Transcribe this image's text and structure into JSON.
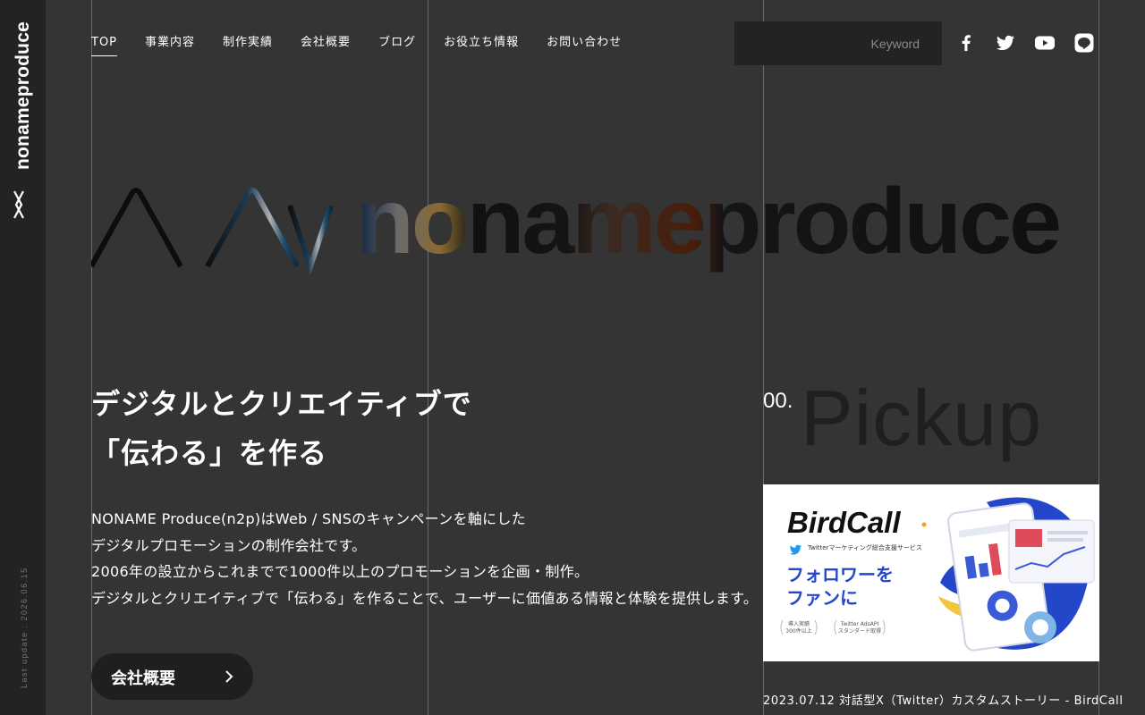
{
  "sidebar": {
    "brand": "nonameproduce",
    "last_update": "Last update : 2026.06.15"
  },
  "nav": {
    "items": [
      {
        "label": "TOP",
        "active": true
      },
      {
        "label": "事業内容"
      },
      {
        "label": "制作実績"
      },
      {
        "label": "会社概要"
      },
      {
        "label": "ブログ"
      },
      {
        "label": "お役立ち情報"
      },
      {
        "label": "お問い合わせ"
      }
    ]
  },
  "search": {
    "placeholder": "Keyword"
  },
  "social": [
    "facebook-icon",
    "twitter-icon",
    "youtube-icon",
    "line-icon"
  ],
  "hero": {
    "logo_text": "nonameproduce",
    "catch": [
      "デジタルとクリエイティブで",
      "「伝わる」を作る"
    ],
    "description": [
      "NONAME Produce(n2p)はWeb / SNSのキャンペーンを軸にした",
      "デジタルプロモーションの制作会社です。",
      "2006年の設立からこれまでで1000件以上のプロモーションを企画・制作。",
      "デジタルとクリエイティブで「伝わる」を作ることで、ユーザーに価値ある情報と体験を提供します。"
    ],
    "button_label": "会社概要"
  },
  "pickup": {
    "number": "00.",
    "title": "Pickup",
    "card": {
      "brand": "BirdCall",
      "sub": "Twitterマーケティング総合支援サービス",
      "headline_1": "フォロワーを",
      "headline_2": "ファンに",
      "badge_1a": "導入実績",
      "badge_1b": "300件以上",
      "badge_2a": "Twitter AdsAPI",
      "badge_2b": "スタンダード取得"
    },
    "caption": "2023.07.12 対話型X（Twitter）カスタムストーリー - BirdCall"
  },
  "colors": {
    "background": "#353435",
    "sidebar": "#232323",
    "grid_line": "#6b6a6b",
    "accent_blue": "#1f3fbf"
  }
}
